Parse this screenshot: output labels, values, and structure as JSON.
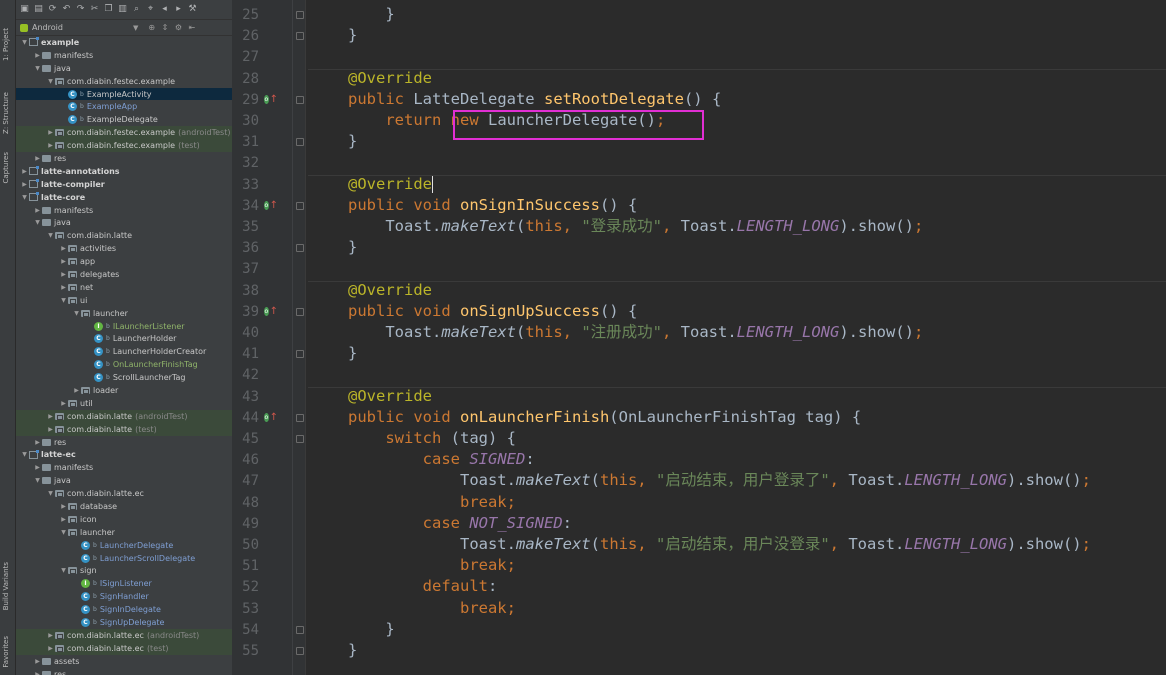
{
  "sidestrip": {
    "project": "1: Project",
    "structure": "Z: Structure",
    "captures": "Captures",
    "build_variants": "Build Variants",
    "favorites": "Favorites"
  },
  "project_view": {
    "mode": "Android"
  },
  "tree": [
    {
      "label": "example",
      "depth": 0,
      "icon": "module",
      "arrow": "down",
      "bold": true
    },
    {
      "label": "manifests",
      "depth": 1,
      "icon": "folder",
      "arrow": "right"
    },
    {
      "label": "java",
      "depth": 1,
      "icon": "folder",
      "arrow": "down"
    },
    {
      "label": "com.diabin.festec.example",
      "depth": 2,
      "icon": "package",
      "arrow": "down"
    },
    {
      "label": "ExampleActivity",
      "depth": 3,
      "icon": "class",
      "selected": true
    },
    {
      "label": "ExampleApp",
      "depth": 3,
      "icon": "class",
      "color": "blue"
    },
    {
      "label": "ExampleDelegate",
      "depth": 3,
      "icon": "class"
    },
    {
      "label": "com.diabin.festec.example",
      "suffix": "(androidTest)",
      "depth": 2,
      "icon": "package",
      "arrow": "right",
      "tint": true
    },
    {
      "label": "com.diabin.festec.example",
      "suffix": "(test)",
      "depth": 2,
      "icon": "package",
      "arrow": "right",
      "tint": true
    },
    {
      "label": "res",
      "depth": 1,
      "icon": "folder",
      "arrow": "right"
    },
    {
      "label": "latte-annotations",
      "depth": 0,
      "icon": "module",
      "arrow": "right",
      "bold": true
    },
    {
      "label": "latte-compiler",
      "depth": 0,
      "icon": "module",
      "arrow": "right",
      "bold": true
    },
    {
      "label": "latte-core",
      "depth": 0,
      "icon": "module",
      "arrow": "down",
      "bold": true
    },
    {
      "label": "manifests",
      "depth": 1,
      "icon": "folder",
      "arrow": "right"
    },
    {
      "label": "java",
      "depth": 1,
      "icon": "folder",
      "arrow": "down"
    },
    {
      "label": "com.diabin.latte",
      "depth": 2,
      "icon": "package",
      "arrow": "down"
    },
    {
      "label": "activities",
      "depth": 3,
      "icon": "package",
      "arrow": "right"
    },
    {
      "label": "app",
      "depth": 3,
      "icon": "package",
      "arrow": "right"
    },
    {
      "label": "delegates",
      "depth": 3,
      "icon": "package",
      "arrow": "right"
    },
    {
      "label": "net",
      "depth": 3,
      "icon": "package",
      "arrow": "right"
    },
    {
      "label": "ui",
      "depth": 3,
      "icon": "package",
      "arrow": "down"
    },
    {
      "label": "launcher",
      "depth": 4,
      "icon": "package",
      "arrow": "down"
    },
    {
      "label": "ILauncherListener",
      "depth": 5,
      "icon": "interface",
      "color": "green"
    },
    {
      "label": "LauncherHolder",
      "depth": 5,
      "icon": "class"
    },
    {
      "label": "LauncherHolderCreator",
      "depth": 5,
      "icon": "class"
    },
    {
      "label": "OnLauncherFinishTag",
      "depth": 5,
      "icon": "class",
      "color": "green"
    },
    {
      "label": "ScrollLauncherTag",
      "depth": 5,
      "icon": "class"
    },
    {
      "label": "loader",
      "depth": 4,
      "icon": "package",
      "arrow": "right"
    },
    {
      "label": "util",
      "depth": 3,
      "icon": "package",
      "arrow": "right"
    },
    {
      "label": "com.diabin.latte",
      "suffix": "(androidTest)",
      "depth": 2,
      "icon": "package",
      "arrow": "right",
      "tint": true
    },
    {
      "label": "com.diabin.latte",
      "suffix": "(test)",
      "depth": 2,
      "icon": "package",
      "arrow": "right",
      "tint": true
    },
    {
      "label": "res",
      "depth": 1,
      "icon": "folder",
      "arrow": "right"
    },
    {
      "label": "latte-ec",
      "depth": 0,
      "icon": "module",
      "arrow": "down",
      "bold": true
    },
    {
      "label": "manifests",
      "depth": 1,
      "icon": "folder",
      "arrow": "right"
    },
    {
      "label": "java",
      "depth": 1,
      "icon": "folder",
      "arrow": "down"
    },
    {
      "label": "com.diabin.latte.ec",
      "depth": 2,
      "icon": "package",
      "arrow": "down"
    },
    {
      "label": "database",
      "depth": 3,
      "icon": "package",
      "arrow": "right"
    },
    {
      "label": "icon",
      "depth": 3,
      "icon": "package",
      "arrow": "right"
    },
    {
      "label": "launcher",
      "depth": 3,
      "icon": "package",
      "arrow": "down"
    },
    {
      "label": "LauncherDelegate",
      "depth": 4,
      "icon": "class",
      "color": "blue"
    },
    {
      "label": "LauncherScrollDelegate",
      "depth": 4,
      "icon": "class",
      "color": "blue"
    },
    {
      "label": "sign",
      "depth": 3,
      "icon": "package",
      "arrow": "down"
    },
    {
      "label": "ISignListener",
      "depth": 4,
      "icon": "interface",
      "color": "blue"
    },
    {
      "label": "SignHandler",
      "depth": 4,
      "icon": "class",
      "color": "blue"
    },
    {
      "label": "SignInDelegate",
      "depth": 4,
      "icon": "class",
      "color": "blue"
    },
    {
      "label": "SignUpDelegate",
      "depth": 4,
      "icon": "class",
      "color": "blue"
    },
    {
      "label": "com.diabin.latte.ec",
      "suffix": "(androidTest)",
      "depth": 2,
      "icon": "package",
      "arrow": "right",
      "tint": true
    },
    {
      "label": "com.diabin.latte.ec",
      "suffix": "(test)",
      "depth": 2,
      "icon": "package",
      "arrow": "right",
      "tint": true
    },
    {
      "label": "assets",
      "depth": 1,
      "icon": "folder",
      "arrow": "right"
    },
    {
      "label": "res",
      "depth": 1,
      "icon": "folder",
      "arrow": "right"
    }
  ],
  "editor": {
    "lines": [
      {
        "n": "25",
        "tokens": [
          [
            "p",
            "    }"
          ]
        ]
      },
      {
        "n": "26",
        "tokens": [
          [
            "p",
            "}"
          ]
        ]
      },
      {
        "n": "27",
        "tokens": []
      },
      {
        "n": "28",
        "tokens": [
          [
            "an",
            "@Override"
          ]
        ]
      },
      {
        "n": "29",
        "marker": true,
        "tokens": [
          [
            "k",
            "public "
          ],
          [
            "p",
            "LatteDelegate "
          ],
          [
            "fn",
            "setRootDelegate"
          ],
          [
            "p",
            "() {"
          ]
        ]
      },
      {
        "n": "30",
        "tokens": [
          [
            "k",
            "    return new "
          ],
          [
            "p",
            "LauncherDelegate()"
          ],
          [
            "k",
            ";"
          ]
        ]
      },
      {
        "n": "31",
        "tokens": [
          [
            "p",
            "}"
          ]
        ]
      },
      {
        "n": "32",
        "tokens": []
      },
      {
        "n": "33",
        "cursor": true,
        "tokens": [
          [
            "an",
            "@Override"
          ]
        ]
      },
      {
        "n": "34",
        "marker": true,
        "tokens": [
          [
            "k",
            "public void "
          ],
          [
            "fn",
            "onSignInSuccess"
          ],
          [
            "p",
            "() {"
          ]
        ]
      },
      {
        "n": "35",
        "tokens": [
          [
            "p",
            "    Toast."
          ],
          [
            "it",
            "makeText"
          ],
          [
            "p",
            "("
          ],
          [
            "k",
            "this, "
          ],
          [
            "st",
            "\"登录成功\""
          ],
          [
            "k",
            ", "
          ],
          [
            "p",
            "Toast."
          ],
          [
            "fi",
            "LENGTH_LONG"
          ],
          [
            "p",
            ").show()"
          ],
          [
            "k",
            ";"
          ]
        ]
      },
      {
        "n": "36",
        "tokens": [
          [
            "p",
            "}"
          ]
        ]
      },
      {
        "n": "37",
        "tokens": []
      },
      {
        "n": "38",
        "tokens": [
          [
            "an",
            "@Override"
          ]
        ]
      },
      {
        "n": "39",
        "marker": true,
        "tokens": [
          [
            "k",
            "public void "
          ],
          [
            "fn",
            "onSignUpSuccess"
          ],
          [
            "p",
            "() {"
          ]
        ]
      },
      {
        "n": "40",
        "tokens": [
          [
            "p",
            "    Toast."
          ],
          [
            "it",
            "makeText"
          ],
          [
            "p",
            "("
          ],
          [
            "k",
            "this, "
          ],
          [
            "st",
            "\"注册成功\""
          ],
          [
            "k",
            ", "
          ],
          [
            "p",
            "Toast."
          ],
          [
            "fi",
            "LENGTH_LONG"
          ],
          [
            "p",
            ").show()"
          ],
          [
            "k",
            ";"
          ]
        ]
      },
      {
        "n": "41",
        "tokens": [
          [
            "p",
            "}"
          ]
        ]
      },
      {
        "n": "42",
        "tokens": []
      },
      {
        "n": "43",
        "tokens": [
          [
            "an",
            "@Override"
          ]
        ]
      },
      {
        "n": "44",
        "marker": true,
        "tokens": [
          [
            "k",
            "public void "
          ],
          [
            "fn",
            "onLauncherFinish"
          ],
          [
            "p",
            "(OnLauncherFinishTag tag) {"
          ]
        ]
      },
      {
        "n": "45",
        "tokens": [
          [
            "k",
            "    switch "
          ],
          [
            "p",
            "(tag) {"
          ]
        ]
      },
      {
        "n": "46",
        "tokens": [
          [
            "k",
            "        case "
          ],
          [
            "fi",
            "SIGNED"
          ],
          [
            "p",
            ":"
          ]
        ]
      },
      {
        "n": "47",
        "tokens": [
          [
            "p",
            "            Toast."
          ],
          [
            "it",
            "makeText"
          ],
          [
            "p",
            "("
          ],
          [
            "k",
            "this, "
          ],
          [
            "st",
            "\"启动结束，用户登录了\""
          ],
          [
            "k",
            ", "
          ],
          [
            "p",
            "Toast."
          ],
          [
            "fi",
            "LENGTH_LONG"
          ],
          [
            "p",
            ").show()"
          ],
          [
            "k",
            ";"
          ]
        ]
      },
      {
        "n": "48",
        "tokens": [
          [
            "k",
            "            break;"
          ]
        ]
      },
      {
        "n": "49",
        "tokens": [
          [
            "k",
            "        case "
          ],
          [
            "fi",
            "NOT_SIGNED"
          ],
          [
            "p",
            ":"
          ]
        ]
      },
      {
        "n": "50",
        "tokens": [
          [
            "p",
            "            Toast."
          ],
          [
            "it",
            "makeText"
          ],
          [
            "p",
            "("
          ],
          [
            "k",
            "this, "
          ],
          [
            "st",
            "\"启动结束，用户没登录\""
          ],
          [
            "k",
            ", "
          ],
          [
            "p",
            "Toast."
          ],
          [
            "fi",
            "LENGTH_LONG"
          ],
          [
            "p",
            ").show()"
          ],
          [
            "k",
            ";"
          ]
        ]
      },
      {
        "n": "51",
        "tokens": [
          [
            "k",
            "            break;"
          ]
        ]
      },
      {
        "n": "52",
        "tokens": [
          [
            "k",
            "        default"
          ],
          [
            "p",
            ":"
          ]
        ]
      },
      {
        "n": "53",
        "tokens": [
          [
            "k",
            "            break;"
          ]
        ]
      },
      {
        "n": "54",
        "tokens": [
          [
            "p",
            "    }"
          ]
        ]
      },
      {
        "n": "55",
        "tokens": [
          [
            "p",
            "}"
          ]
        ]
      }
    ]
  }
}
